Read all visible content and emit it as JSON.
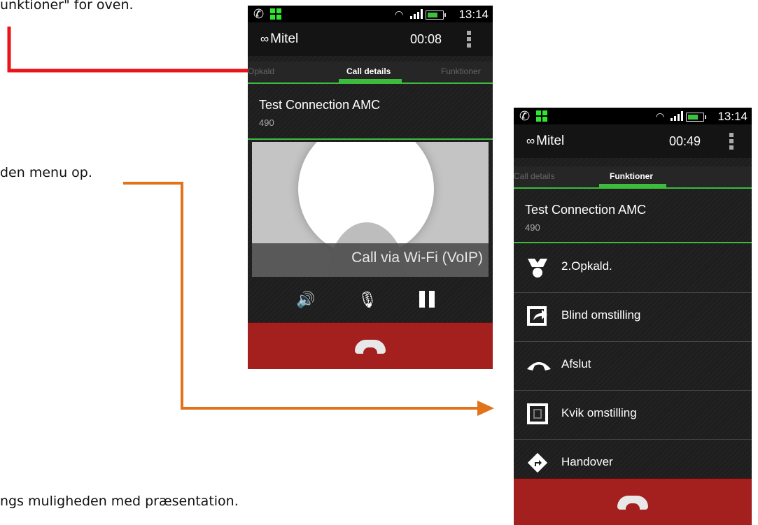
{
  "document": {
    "line1": "unktioner\" for oven.",
    "line2": "den menu op.",
    "line3": "ngs muligheden med præsentation."
  },
  "phone1": {
    "status": {
      "time": "13:14"
    },
    "app": {
      "name": "Mitel",
      "timer": "00:08"
    },
    "tabs": [
      "Opkald",
      "Call details",
      "Funktioner"
    ],
    "active_tab": "Call details",
    "contact": {
      "name": "Test Connection AMC",
      "number": "490"
    },
    "banner": "Call via Wi-Fi (VoIP)",
    "controls": [
      "speaker-icon",
      "mute-mic-icon",
      "pause-icon"
    ],
    "end_call": "end-call-icon"
  },
  "phone2": {
    "status": {
      "time": "13:14"
    },
    "app": {
      "name": "Mitel",
      "timer": "00:49"
    },
    "tabs": [
      "Call details",
      "Funktioner"
    ],
    "active_tab": "Funktioner",
    "contact": {
      "name": "Test Connection AMC",
      "number": "490"
    },
    "functions": [
      {
        "label": "2.Opkald.",
        "icon": "second-call-icon"
      },
      {
        "label": "Blind omstilling",
        "icon": "blind-transfer-icon"
      },
      {
        "label": "Afslut",
        "icon": "hangup-icon"
      },
      {
        "label": "Kvik omstilling",
        "icon": "quick-transfer-icon"
      },
      {
        "label": "Handover",
        "icon": "handover-icon"
      }
    ],
    "end_call": "end-call-icon"
  },
  "colors": {
    "accent_green": "#3dbb3d",
    "end_call_red": "#a3201f",
    "arrow_red": "#e8141a",
    "arrow_orange": "#e2731a"
  }
}
